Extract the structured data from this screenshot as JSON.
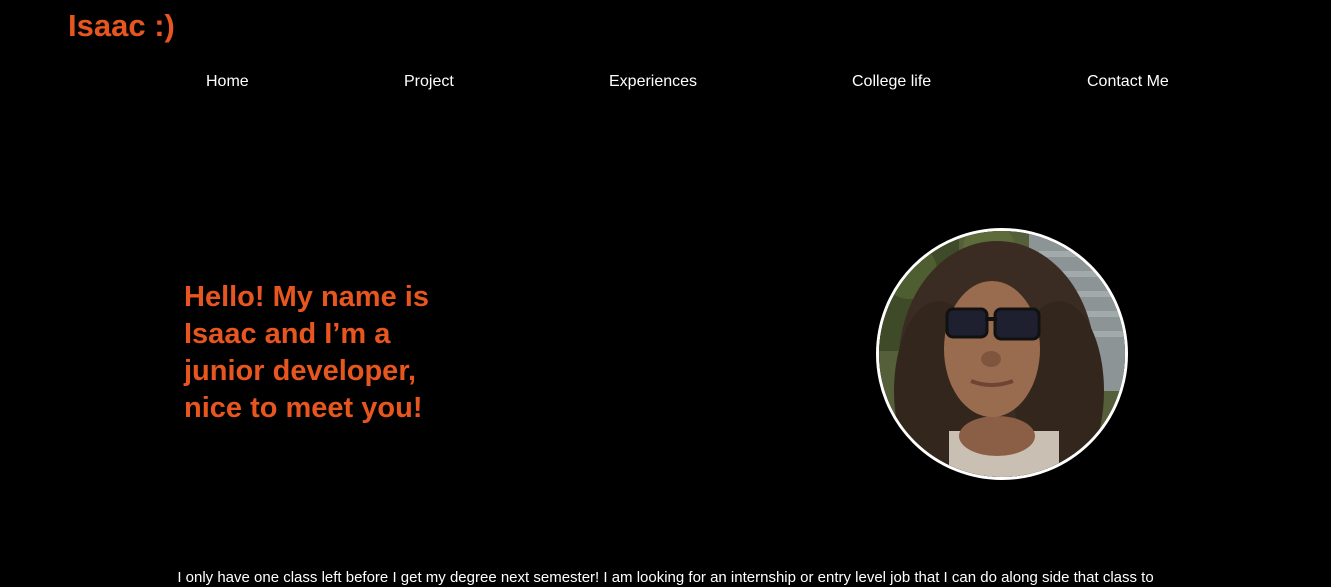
{
  "header": {
    "logo_text": "Isaac :)"
  },
  "nav": {
    "items": [
      {
        "label": "Home"
      },
      {
        "label": "Project"
      },
      {
        "label": "Experiences"
      },
      {
        "label": "College life"
      },
      {
        "label": "Contact Me"
      }
    ]
  },
  "hero": {
    "heading": "Hello! My name is Isaac and I’m a junior developer, nice to meet you!",
    "photo_icon": "profile-photo"
  },
  "about": {
    "text": "I only have one class left before I get my degree next semester! I am looking for an internship or entry level job that I can do along side that class to"
  },
  "colors": {
    "background": "#000000",
    "accent": "#e8561f",
    "text": "#ffffff"
  }
}
